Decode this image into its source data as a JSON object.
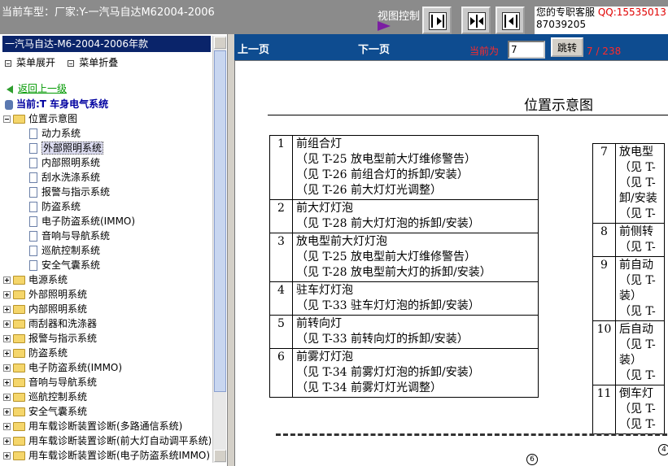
{
  "header": {
    "car_title": "当前车型：厂家:Y-一汽马自达M62004-2006",
    "view_control_label": "视图控制",
    "view_buttons": [
      "next-page-view",
      "two-page-view",
      "prev-page-view"
    ],
    "service_label": "您的专职客服",
    "service_qq": "QQ:15535013",
    "service_phone": "87039205",
    "colors": {
      "bar": "#8b8b8b",
      "qq": "#e00000"
    }
  },
  "sidebar": {
    "title": "一汽马自达-M6-2004-2006年款",
    "expand_label": "菜单展开",
    "collapse_label": "菜单折叠",
    "back_label": "返回上一级",
    "current_label": "当前:T 车身电气系统",
    "open_folder": "位置示意图",
    "children": [
      "动力系统",
      "外部照明系统",
      "内部照明系统",
      "刮水洗涤系统",
      "报警与指示系统",
      "防盗系统",
      "电子防盗系统(IMMO)",
      "音响与导航系统",
      "巡航控制系统",
      "安全气囊系统"
    ],
    "selected_child_index": 1,
    "folders": [
      "电源系统",
      "外部照明系统",
      "内部照明系统",
      "雨刮器和洗涤器",
      "报警与指示系统",
      "防盗系统",
      "电子防盗系统(IMMO)",
      "音响与导航系统",
      "巡航控制系统",
      "安全气囊系统",
      "用车载诊断装置诊断(多路通信系统)",
      "用车载诊断装置诊断(前大灯自动调平系统)",
      "用车载诊断装置诊断(电子防盗系统IMMO)"
    ]
  },
  "nav": {
    "prev_label": "上一页",
    "next_label": "下一页",
    "current_label": "当前为",
    "page_value": "7",
    "jump_label": "跳转",
    "page_count": "7 / 238",
    "colors": {
      "bar": "#0e4c90",
      "current": "#ff2a2a"
    }
  },
  "document": {
    "title": "位置示意图",
    "left_table": [
      {
        "num": "1",
        "lines": [
          "前组合灯",
          "（见 T-25 放电型前大灯维修警告）",
          "（见 T-26 前组合灯的拆卸/安装）",
          "（见 T-26 前大灯灯光调整）"
        ]
      },
      {
        "num": "2",
        "lines": [
          "前大灯灯泡",
          "（见 T-28 前大灯灯泡的拆卸/安装）"
        ]
      },
      {
        "num": "3",
        "lines": [
          "放电型前大灯灯泡",
          "（见 T-25 放电型前大灯维修警告）",
          "（见 T-28 放电型前大灯的拆卸/安装）"
        ]
      },
      {
        "num": "4",
        "lines": [
          "驻车灯灯泡",
          "（见 T-33 驻车灯灯泡的拆卸/安装）"
        ]
      },
      {
        "num": "5",
        "lines": [
          "前转向灯",
          "（见 T-33 前转向灯的拆卸/安装）"
        ]
      },
      {
        "num": "6",
        "lines": [
          "前雾灯灯泡",
          "（见 T-34 前雾灯灯泡的拆卸/安装）",
          "（见 T-34 前雾灯灯光调整）"
        ]
      }
    ],
    "right_table": [
      {
        "num": "7",
        "lines": [
          "放电型",
          "（见 T-",
          "（见 T-",
          "卸/安装",
          "（见 T-"
        ]
      },
      {
        "num": "8",
        "lines": [
          "前侧转",
          "（见 T-"
        ]
      },
      {
        "num": "9",
        "lines": [
          "前自动",
          "（见 T-",
          "装）",
          "（见 T-"
        ]
      },
      {
        "num": "10",
        "lines": [
          "后自动",
          "（见 T-",
          "装）",
          "（见 T-"
        ]
      },
      {
        "num": "11",
        "lines": [
          "倒车灯",
          "（见 T-",
          "（见 T-"
        ]
      }
    ],
    "diagram_callouts": [
      "6",
      "4"
    ]
  }
}
